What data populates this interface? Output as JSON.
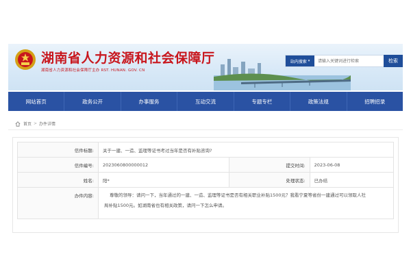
{
  "header": {
    "site_title": "湖南省人力资源和社会保障厅",
    "site_subtitle": "湖南省人力资源和社会保障厅主办   RST. HUNAN. GOV. CN"
  },
  "search": {
    "scope_label": "站内搜索",
    "placeholder": "请输入关键词进行检索",
    "button_label": "检索"
  },
  "nav": {
    "items": [
      "网站首页",
      "政务公开",
      "办事服务",
      "互动交流",
      "专题专栏",
      "政策法规",
      "招聘招录"
    ]
  },
  "breadcrumb": {
    "home": "首页",
    "current": "办件详情"
  },
  "letter": {
    "title_label": "信件标题:",
    "title_value": "关于一建、一造、监理等证书考过当年是否有补贴咨询?",
    "number_label": "信件编号:",
    "number_value": "2023060800000012",
    "date_label": "提交时间:",
    "date_value": "2023-06-08",
    "name_label": "姓名:",
    "name_value": "阳*",
    "status_label": "处理状态:",
    "status_value": "已办结",
    "content_label": "办件内容:",
    "content_line1": "尊敬的领导：请问一下，当年通过的一建、一造、监理等证书是否有相关职业补贴1500元？我看宁夏等省份一建通过可以领取人社",
    "content_line2": "局补贴1500元。如湖南省也有相关政策，请问一下怎么申请。"
  },
  "colors": {
    "title_red": "#c8161d",
    "nav_blue": "#2a52a3"
  }
}
